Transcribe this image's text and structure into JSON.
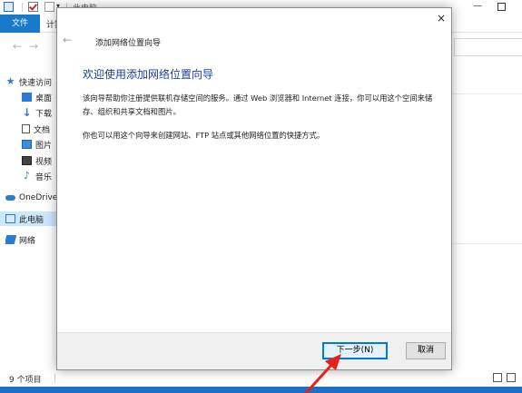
{
  "titlebar": {
    "title": "此电脑",
    "minimize": "—",
    "qa_dropdown": "▾"
  },
  "ribbon": {
    "file_tab": "文件",
    "computer_tab": "计算机"
  },
  "nav": {
    "back": "←",
    "forward": "→"
  },
  "sidebar": {
    "items": [
      {
        "label": "快速访问",
        "icon": "star-icon"
      },
      {
        "label": "桌面",
        "icon": "desktop-icon"
      },
      {
        "label": "下载",
        "icon": "download-icon"
      },
      {
        "label": "文档",
        "icon": "document-icon"
      },
      {
        "label": "图片",
        "icon": "pictures-icon"
      },
      {
        "label": "视频",
        "icon": "videos-icon"
      },
      {
        "label": "音乐",
        "icon": "music-icon"
      },
      {
        "label": "OneDrive",
        "icon": "onedrive-icon"
      },
      {
        "label": "此电脑",
        "icon": "this-pc-icon",
        "selected": true
      },
      {
        "label": "网络",
        "icon": "network-icon"
      }
    ]
  },
  "status": {
    "item_count": "9 个项目"
  },
  "dialog": {
    "close": "×",
    "back": "←",
    "window_title": "添加网络位置向导",
    "heading": "欢迎使用添加网络位置向导",
    "paragraph1": "该向导帮助你注册提供联机存储空间的服务。通过 Web 浏览器和 Internet 连接，你可以用这个空间来储存、组织和共享文档和图片。",
    "paragraph2": "你也可以用这个向导来创建网站、FTP 站点或其他网络位置的快捷方式。",
    "next_button": "下一步(N)",
    "cancel_button": "取消"
  },
  "annotation": {
    "arrow_color": "#e8201a"
  }
}
